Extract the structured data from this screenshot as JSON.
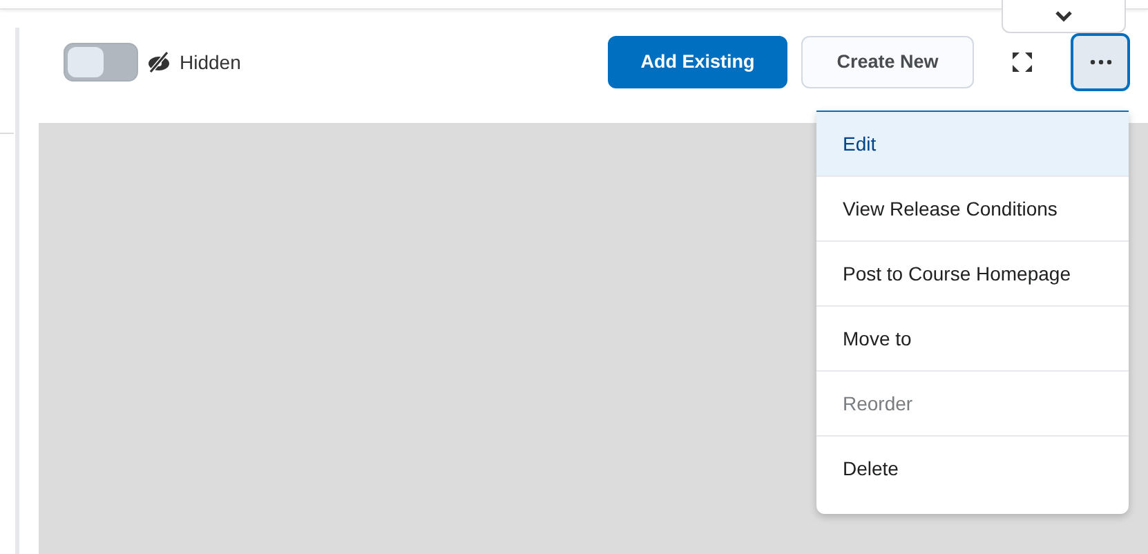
{
  "visibility_toggle": {
    "on": false,
    "label": "Hidden"
  },
  "buttons": [
    {
      "label": "Add Existing",
      "kind": "primary"
    },
    {
      "label": "Create New",
      "kind": "secondary"
    }
  ],
  "more_button": {
    "expanded": true
  },
  "menu": [
    {
      "label": "Edit",
      "selected": true,
      "disabled": false
    },
    {
      "label": "View Release Conditions",
      "selected": false,
      "disabled": false
    },
    {
      "label": "Post to Course Homepage",
      "selected": false,
      "disabled": false
    },
    {
      "label": "Move to",
      "selected": false,
      "disabled": false
    },
    {
      "label": "Reorder",
      "selected": false,
      "disabled": true
    },
    {
      "label": "Delete",
      "selected": false,
      "disabled": false
    }
  ]
}
